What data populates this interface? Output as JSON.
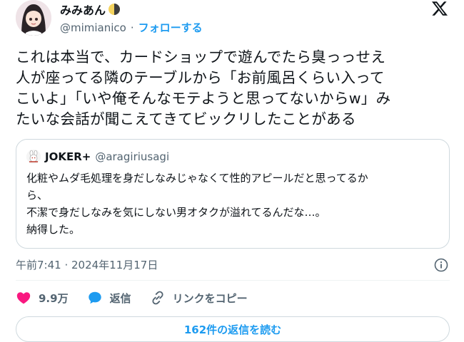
{
  "author": {
    "display_name": "みみあん",
    "handle": "@mimianico",
    "separator": "·",
    "follow_label": "フォローする",
    "avatar_icon": "anime-girl-avatar",
    "badge_icon": "half-moon-icon"
  },
  "header": {
    "logo_icon": "x-logo-icon"
  },
  "tweet": {
    "text": "これは本当で、カードショップで遊んでたら臭っっせえ\n人が座ってる隣のテーブルから「お前風呂くらい入って\nこいよ」「いや俺そんなモテようと思ってないからw」み\nたいな会話が聞こえてきてビックリしたことがある"
  },
  "quote": {
    "name": "JOKER+",
    "handle": "@aragiriusagi",
    "text": "化粧やムダ毛処理を身だしなみじゃなくて性的アピールだと思ってるか\nら、\n不潔で身だしなみを気にしない男オタクが溢れてるんだな…。\n納得した。"
  },
  "meta": {
    "timestamp": "午前7:41 · 2024年11月17日",
    "info_icon": "info-icon"
  },
  "actions": {
    "likes": "9.9万",
    "reply_label": "返信",
    "copy_link_label": "リンクをコピー"
  },
  "footer": {
    "read_replies_label": "162件の返信を読む"
  },
  "colors": {
    "accent": "#1d9bf0",
    "like": "#f91880",
    "muted": "#536471",
    "border": "#cfd9de"
  }
}
